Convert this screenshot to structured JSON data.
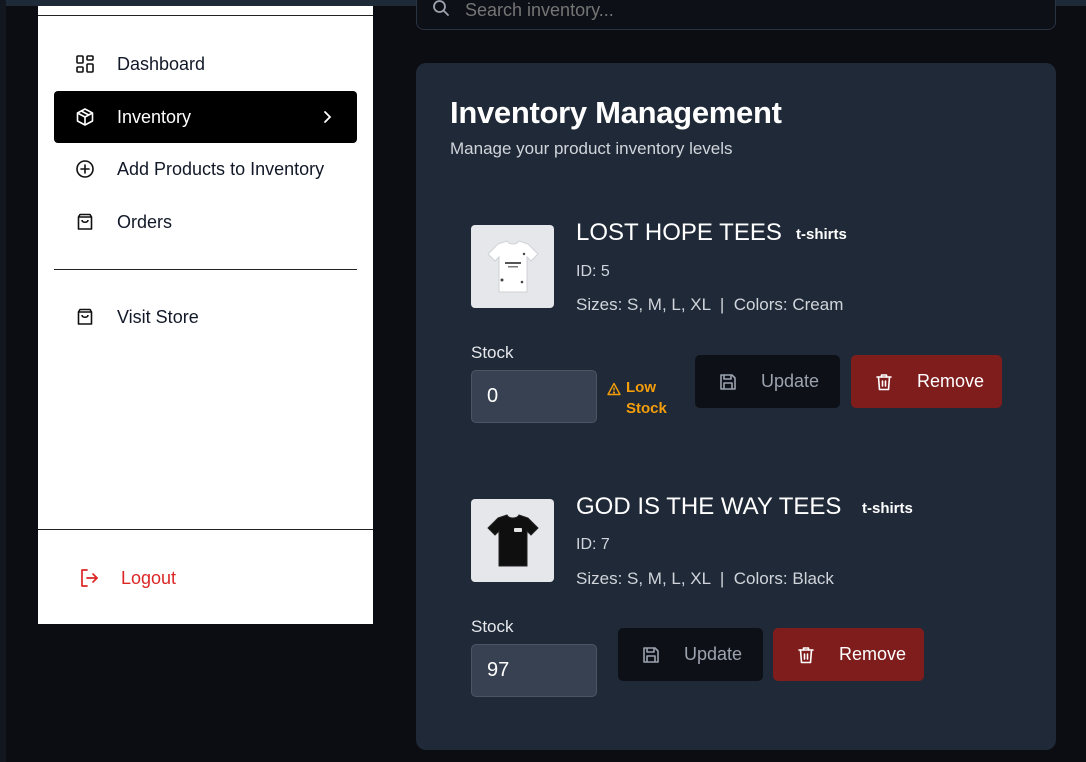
{
  "sidebar": {
    "items": [
      {
        "label": "Dashboard",
        "icon": "dashboard-grid-icon"
      },
      {
        "label": "Inventory",
        "icon": "package-icon",
        "active": true
      },
      {
        "label": "Add Products to Inventory",
        "icon": "plus-circle-icon"
      },
      {
        "label": "Orders",
        "icon": "shopping-bag-icon"
      }
    ],
    "visit_store": {
      "label": "Visit Store",
      "icon": "shopping-bag-icon"
    },
    "logout": {
      "label": "Logout",
      "icon": "logout-icon"
    }
  },
  "search": {
    "placeholder": "Search inventory..."
  },
  "main": {
    "title": "Inventory Management",
    "subtitle": "Manage your product inventory levels"
  },
  "products": [
    {
      "name": "LOST HOPE TEES",
      "category": "t-shirts",
      "id_text": "ID: 5",
      "meta": "Sizes: S, M, L, XL  |  Colors: Cream",
      "stock_label": "Stock",
      "stock_value": "0",
      "low_stock_line1": "Low",
      "low_stock_line2": "Stock",
      "update_label": "Update",
      "remove_label": "Remove"
    },
    {
      "name": "GOD IS THE WAY TEES",
      "category": "t-shirts",
      "id_text": "ID: 7",
      "meta": "Sizes: S, M, L, XL  |  Colors: Black",
      "stock_label": "Stock",
      "stock_value": "97",
      "update_label": "Update",
      "remove_label": "Remove"
    }
  ],
  "colors": {
    "card_bg": "#1f2937",
    "remove_bg": "#7f1d1d",
    "warning": "#f59e0b",
    "logout": "#dc2626"
  }
}
